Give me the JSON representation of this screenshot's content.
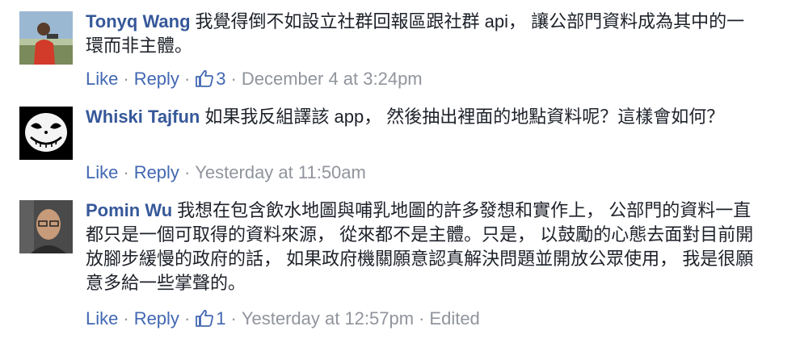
{
  "comments": [
    {
      "author": "Tonyq Wang",
      "text": "我覺得倒不如設立社群回報區跟社群 api， 讓公部門資料成為其中的一環而非主體。",
      "like_label": "Like",
      "reply_label": "Reply",
      "reactions_count": "3",
      "timestamp": "December 4 at 3:24pm",
      "separator": "·"
    },
    {
      "author": "Whiski Tajfun",
      "text": "如果我反組譯該 app， 然後抽出裡面的地點資料呢？這樣會如何？",
      "like_label": "Like",
      "reply_label": "Reply",
      "timestamp": "Yesterday at 11:50am",
      "separator": "·"
    },
    {
      "author": "Pomin Wu",
      "text": "我想在包含飲水地圖與哺乳地圖的許多發想和實作上， 公部門的資料一直都只是一個可取得的資料來源， 從來都不是主體。只是， 以鼓勵的心態去面對目前開放腳步緩慢的政府的話， 如果政府機關願意認真解決問題並開放公眾使用， 我是很願意多給一些掌聲的。",
      "like_label": "Like",
      "reply_label": "Reply",
      "reactions_count": "1",
      "timestamp": "Yesterday at 12:57pm",
      "edited_label": "Edited",
      "separator": "·"
    }
  ],
  "colors": {
    "author": "#365899",
    "action_link": "#4267b2",
    "meta": "#90949c",
    "text": "#1d2129"
  },
  "icons": [
    "thumbs-up-icon"
  ]
}
